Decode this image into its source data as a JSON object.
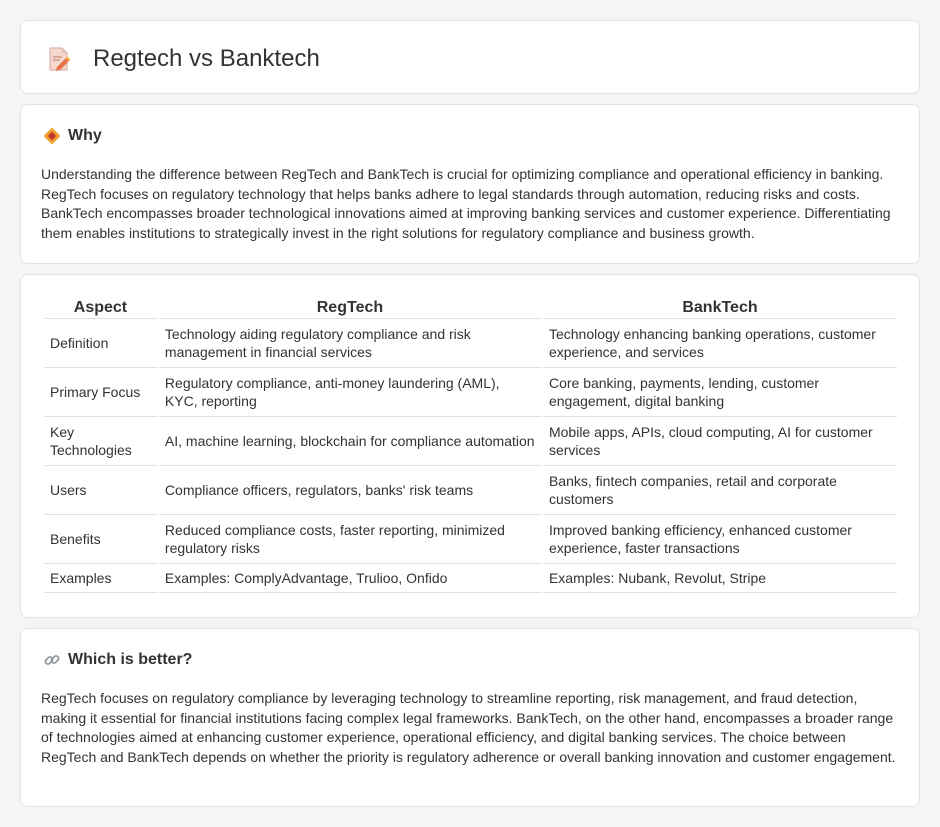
{
  "header": {
    "title": "Regtech vs Banktech",
    "icon": "document-pencil-icon"
  },
  "why": {
    "icon": "diamond-sign-icon",
    "title": "Why",
    "text": "Understanding the difference between RegTech and BankTech is crucial for optimizing compliance and operational efficiency in banking. RegTech focuses on regulatory technology that helps banks adhere to legal standards through automation, reducing risks and costs. BankTech encompasses broader technological innovations aimed at improving banking services and customer experience. Differentiating them enables institutions to strategically invest in the right solutions for regulatory compliance and business growth."
  },
  "table": {
    "headers": [
      "Aspect",
      "RegTech",
      "BankTech"
    ],
    "rows": [
      [
        "Definition",
        "Technology aiding regulatory compliance and risk management in financial services",
        "Technology enhancing banking operations, customer experience, and services"
      ],
      [
        "Primary Focus",
        "Regulatory compliance, anti-money laundering (AML), KYC, reporting",
        "Core banking, payments, lending, customer engagement, digital banking"
      ],
      [
        "Key Technologies",
        "AI, machine learning, blockchain for compliance automation",
        "Mobile apps, APIs, cloud computing, AI for customer services"
      ],
      [
        "Users",
        "Compliance officers, regulators, banks' risk teams",
        "Banks, fintech companies, retail and corporate customers"
      ],
      [
        "Benefits",
        "Reduced compliance costs, faster reporting, minimized regulatory risks",
        "Improved banking efficiency, enhanced customer experience, faster transactions"
      ],
      [
        "Examples",
        "Examples: ComplyAdvantage, Trulioo, Onfido",
        "Examples: Nubank, Revolut, Stripe"
      ]
    ]
  },
  "better": {
    "icon": "link-icon",
    "title": "Which is better?",
    "text": "RegTech focuses on regulatory compliance by leveraging technology to streamline reporting, risk management, and fraud detection, making it essential for financial institutions facing complex legal frameworks. BankTech, on the other hand, encompasses a broader range of technologies aimed at enhancing customer experience, operational efficiency, and digital banking services. The choice between RegTech and BankTech depends on whether the priority is regulatory adherence or overall banking innovation and customer engagement."
  },
  "colors": {
    "background": "#f4f5f7",
    "card": "#ffffff",
    "border": "#e2e4e8",
    "text": "#333333",
    "accent_orange": "#f0a030"
  }
}
